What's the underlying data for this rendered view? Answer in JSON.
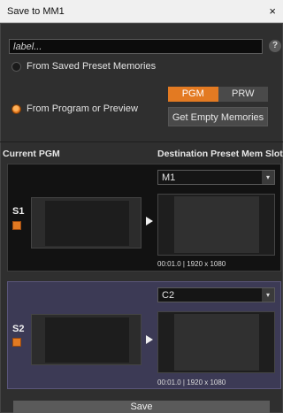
{
  "window": {
    "title": "Save to MM1",
    "close_glyph": "×"
  },
  "label_field": {
    "placeholder": "label...",
    "value": ""
  },
  "help_glyph": "?",
  "options": {
    "saved_presets": {
      "label": "From Saved Preset Memories",
      "selected": false
    },
    "program_preview": {
      "label": "From Program or Preview",
      "selected": true
    }
  },
  "source_toggle": {
    "pgm": "PGM",
    "prw": "PRW",
    "active": "PGM"
  },
  "get_empty_label": "Get Empty Memories",
  "columns": {
    "current": "Current PGM",
    "destination": "Destination Preset Mem Slot"
  },
  "slots": [
    {
      "label": "S1",
      "checked": true,
      "destination": "M1",
      "meta": "00:01.0 | 1920 x 1080"
    },
    {
      "label": "S2",
      "checked": true,
      "destination": "C2",
      "meta": "00:01.0 | 1920 x 1080"
    }
  ],
  "save_label": "Save",
  "colors": {
    "accent": "#e37a22",
    "slot2_bg": "#3c3a55",
    "panel_bg": "#2f2f2f"
  },
  "icons": {
    "close": "close-icon",
    "help": "help-icon",
    "dropdown": "chevron-down-icon",
    "play": "play-arrow-icon"
  }
}
